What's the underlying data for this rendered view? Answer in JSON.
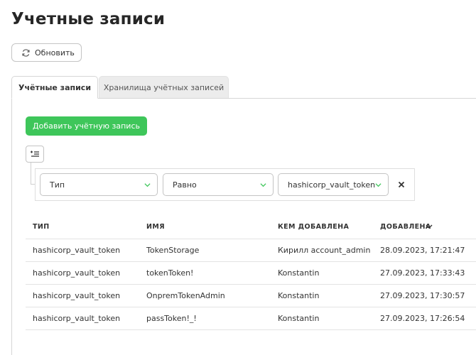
{
  "page": {
    "title": "Учетные записи"
  },
  "toolbar": {
    "refresh_label": "Обновить"
  },
  "tabs": [
    {
      "label": "Учётные записи",
      "active": true
    },
    {
      "label": "Хранилища учётных записей",
      "active": false
    }
  ],
  "actions": {
    "add_label": "Добавить учётную запись"
  },
  "filter": {
    "field": "Тип",
    "operator": "Равно",
    "value": "hashicorp_vault_token"
  },
  "table": {
    "columns": [
      "ТИП",
      "ИМЯ",
      "КЕМ ДОБАВЛЕНА",
      "ДОБАВЛЕНА"
    ],
    "sort_column": "ДОБАВЛЕНА",
    "sort_direction": "desc",
    "rows": [
      [
        "hashicorp_vault_token",
        "TokenStorage",
        "Кирилл account_admin",
        "28.09.2023, 17:21:47"
      ],
      [
        "hashicorp_vault_token",
        "tokenToken!",
        "Konstantin",
        "27.09.2023, 17:33:43"
      ],
      [
        "hashicorp_vault_token",
        "OnpremTokenAdmin",
        "Konstantin",
        "27.09.2023, 17:30:57"
      ],
      [
        "hashicorp_vault_token",
        "passToken!_!",
        "Konstantin",
        "27.09.2023, 17:26:54"
      ]
    ]
  },
  "colors": {
    "accent": "#3ec65a",
    "border": "#c4c4c4"
  }
}
